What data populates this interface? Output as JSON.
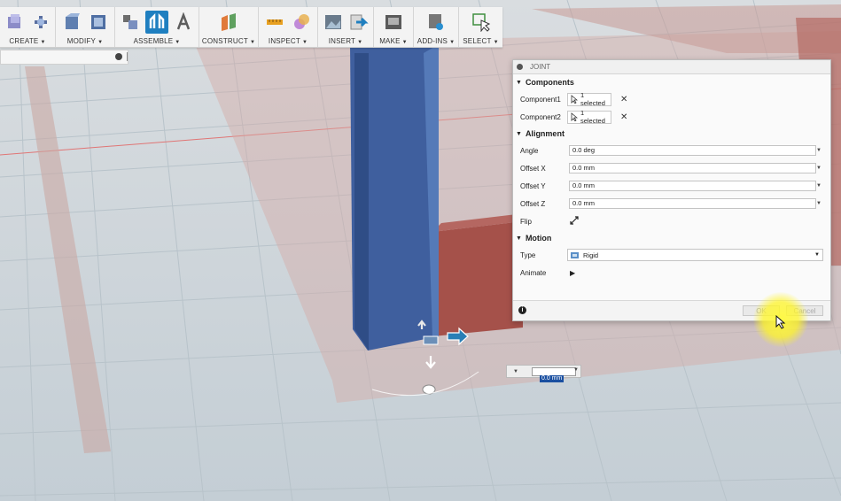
{
  "toolbar": {
    "groups": [
      {
        "label": "CREATE",
        "icons": [
          "create-sketch-icon",
          "create-form-icon"
        ]
      },
      {
        "label": "MODIFY",
        "icons": [
          "press-pull-icon",
          "fillet-icon"
        ]
      },
      {
        "label": "ASSEMBLE",
        "icons": [
          "new-component-icon",
          "joint-icon",
          "as-built-joint-icon"
        ]
      },
      {
        "label": "CONSTRUCT",
        "icons": [
          "offset-plane-icon"
        ]
      },
      {
        "label": "INSPECT",
        "icons": [
          "measure-icon",
          "interference-icon"
        ]
      },
      {
        "label": "INSERT",
        "icons": [
          "insert-canvas-icon",
          "insert-mesh-icon"
        ]
      },
      {
        "label": "MAKE",
        "icons": [
          "3d-print-icon"
        ]
      },
      {
        "label": "ADD-INS",
        "icons": [
          "scripts-icon"
        ]
      },
      {
        "label": "SELECT",
        "icons": [
          "select-icon"
        ]
      }
    ]
  },
  "dialog": {
    "title": "JOINT",
    "components": {
      "heading": "Components",
      "component1_label": "Component1",
      "component1_value": "1 selected",
      "component2_label": "Component2",
      "component2_value": "1 selected"
    },
    "alignment": {
      "heading": "Alignment",
      "angle_label": "Angle",
      "angle_value": "0.0 deg",
      "offset_x_label": "Offset X",
      "offset_x_value": "0.0 mm",
      "offset_y_label": "Offset Y",
      "offset_y_value": "0.0 mm",
      "offset_z_label": "Offset Z",
      "offset_z_value": "0.0 mm",
      "flip_label": "Flip"
    },
    "motion": {
      "heading": "Motion",
      "type_label": "Type",
      "type_value": "Rigid",
      "animate_label": "Animate"
    },
    "ok_label": "OK",
    "cancel_label": "Cancel"
  },
  "distance_input": {
    "value": "0.0 mm"
  },
  "colors": {
    "accent": "#1f7fc0",
    "blue_body": "#3f5f9e",
    "red_body": "#a5514a",
    "highlight": "#fff23c"
  }
}
